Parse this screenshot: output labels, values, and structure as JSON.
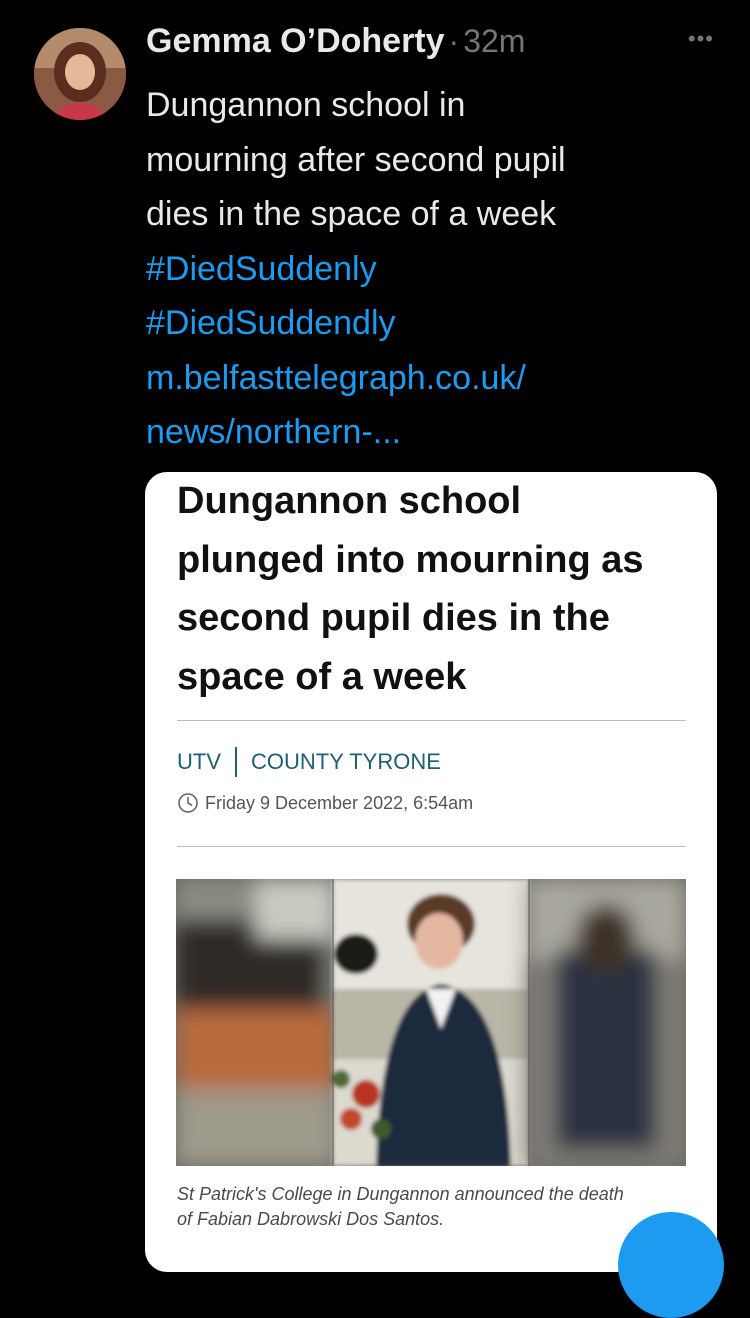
{
  "tweet": {
    "author": "Gemma O’Doherty",
    "separator": "·",
    "time": "32m",
    "more_icon": "ellipsis-icon",
    "text_lines": [
      "Dungannon school in",
      "mourning after second pupil",
      "dies in the space of a week"
    ],
    "hashtags": [
      "#DiedSuddenly",
      "#DiedSuddendly"
    ],
    "link_lines": [
      "m.belfasttelegraph.co.uk/",
      "news/northern-..."
    ]
  },
  "card": {
    "headline_lines": [
      "Dungannon school",
      "plunged into mourning as",
      "second pupil dies in the",
      "space of a week"
    ],
    "source": "UTV",
    "region": "COUNTY TYRONE",
    "date": "Friday 9 December 2022, 6:54am",
    "caption_lines": [
      "St Patrick's College in Dungannon announced the death",
      "of Fabian Dabrowski Dos Santos."
    ]
  },
  "colors": {
    "background": "#000000",
    "link": "#1d9bf0",
    "text": "#e7e9ea",
    "muted": "#71767b",
    "card_accent": "#1f5f6e"
  }
}
